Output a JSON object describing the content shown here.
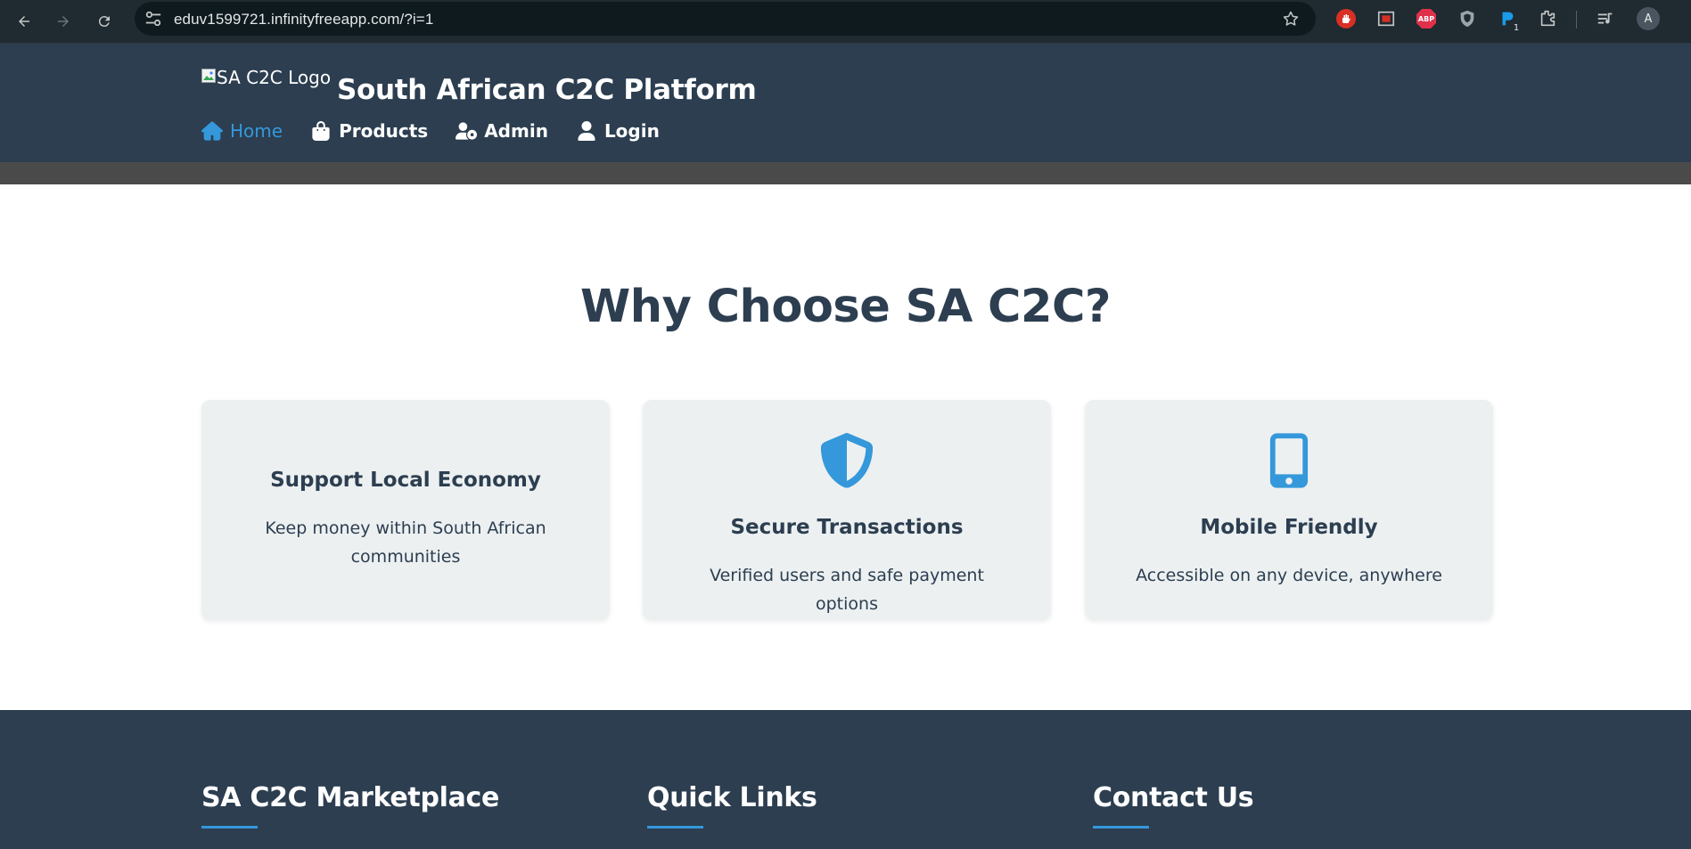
{
  "browser": {
    "url": "eduv1599721.infinityfreeapp.com/?i=1",
    "abp_label": "ABP",
    "ext_badge": "1",
    "profile_initial": "A"
  },
  "header": {
    "logo_alt": "SA C2C Logo",
    "title": "South African C2C Platform",
    "nav": [
      {
        "label": "Home",
        "icon": "home-icon",
        "active": true
      },
      {
        "label": "Products",
        "icon": "shopping-bag-icon",
        "active": false
      },
      {
        "label": "Admin",
        "icon": "user-gear-icon",
        "active": false
      },
      {
        "label": "Login",
        "icon": "user-icon",
        "active": false
      }
    ]
  },
  "features": {
    "title": "Why Choose SA C2C?",
    "cards": [
      {
        "title": "Support Local Economy",
        "text": "Keep money within South African communities",
        "icon": null
      },
      {
        "title": "Secure Transactions",
        "text": "Verified users and safe payment options",
        "icon": "shield-icon"
      },
      {
        "title": "Mobile Friendly",
        "text": "Accessible on any device, anywhere",
        "icon": "mobile-icon"
      }
    ]
  },
  "footer": {
    "columns": [
      {
        "heading": "SA C2C Marketplace"
      },
      {
        "heading": "Quick Links"
      },
      {
        "heading": "Contact Us"
      }
    ]
  },
  "colors": {
    "header_bg": "#2c3e50",
    "accent": "#3498db",
    "card_bg": "#ecf0f1",
    "heading_text": "#2c3e50"
  }
}
